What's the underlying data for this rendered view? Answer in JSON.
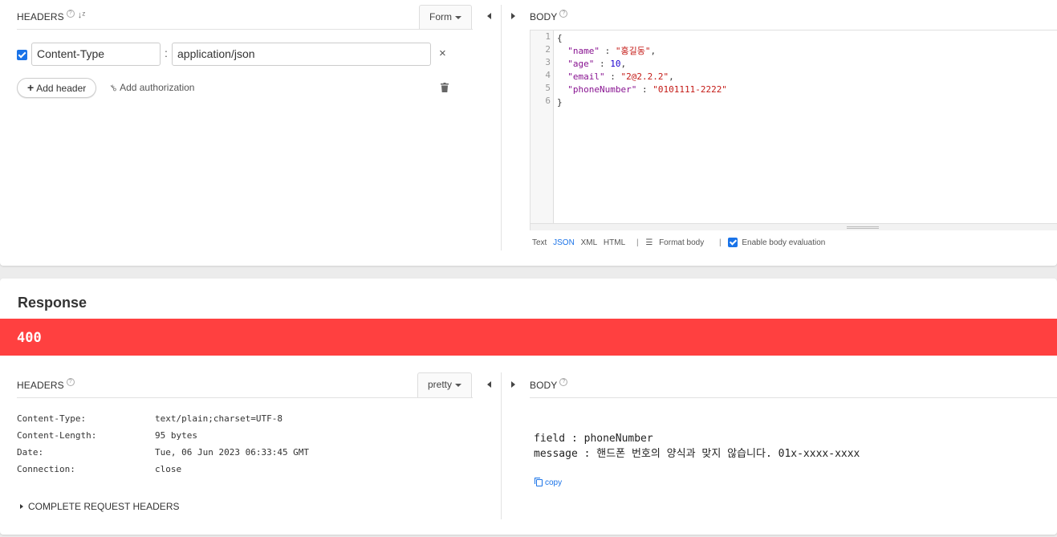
{
  "request": {
    "headers_section": {
      "title": "HEADERS",
      "help": "?",
      "sort_icon": "sort-alpha-icon",
      "mode_dropdown": "Form",
      "rows": [
        {
          "enabled": true,
          "name": "Content-Type",
          "separator": ":",
          "value": "application/json",
          "remove": "×"
        }
      ],
      "add_header_label": "Add header",
      "add_header_plus": "+",
      "add_auth_label": "Add authorization",
      "delete_icon": "trash-icon"
    },
    "body_section": {
      "title": "BODY",
      "help": "?",
      "line_numbers": [
        "1",
        "2",
        "3",
        "4",
        "5",
        "6"
      ],
      "code_lines": [
        "{",
        "  \"name\" : \"홍길동\",",
        "  \"age\" : 10,",
        "  \"email\" : \"2@2.2.2\",",
        "  \"phoneNumber\" : \"0101111-2222\"",
        "}"
      ],
      "formats": [
        "Text",
        "JSON",
        "XML",
        "HTML"
      ],
      "active_format": "JSON",
      "format_body_label": "Format body",
      "enable_eval_label": "Enable body evaluation",
      "enable_eval_checked": true
    }
  },
  "response": {
    "title": "Response",
    "status_code": "400",
    "status_color": "#ff4040",
    "headers_section": {
      "title": "HEADERS",
      "help": "?",
      "mode_dropdown": "pretty",
      "rows": [
        {
          "key": "Content-Type:",
          "value": "text/plain;charset=UTF-8"
        },
        {
          "key": "Content-Length:",
          "value": "95 bytes"
        },
        {
          "key": "Date:",
          "value": "Tue, 06 Jun 2023 06:33:45 GMT"
        },
        {
          "key": "Connection:",
          "value": "close"
        }
      ],
      "complete_request_headers": "COMPLETE REQUEST HEADERS"
    },
    "body_section": {
      "title": "BODY",
      "help": "?",
      "lines": [
        "field : phoneNumber",
        "message : 핸드폰 번호의 양식과 맞지 않습니다. 01x-xxxx-xxxx"
      ],
      "copy_label": "copy"
    }
  },
  "colors": {
    "accent": "#1a73e8",
    "error": "#ff4040"
  }
}
